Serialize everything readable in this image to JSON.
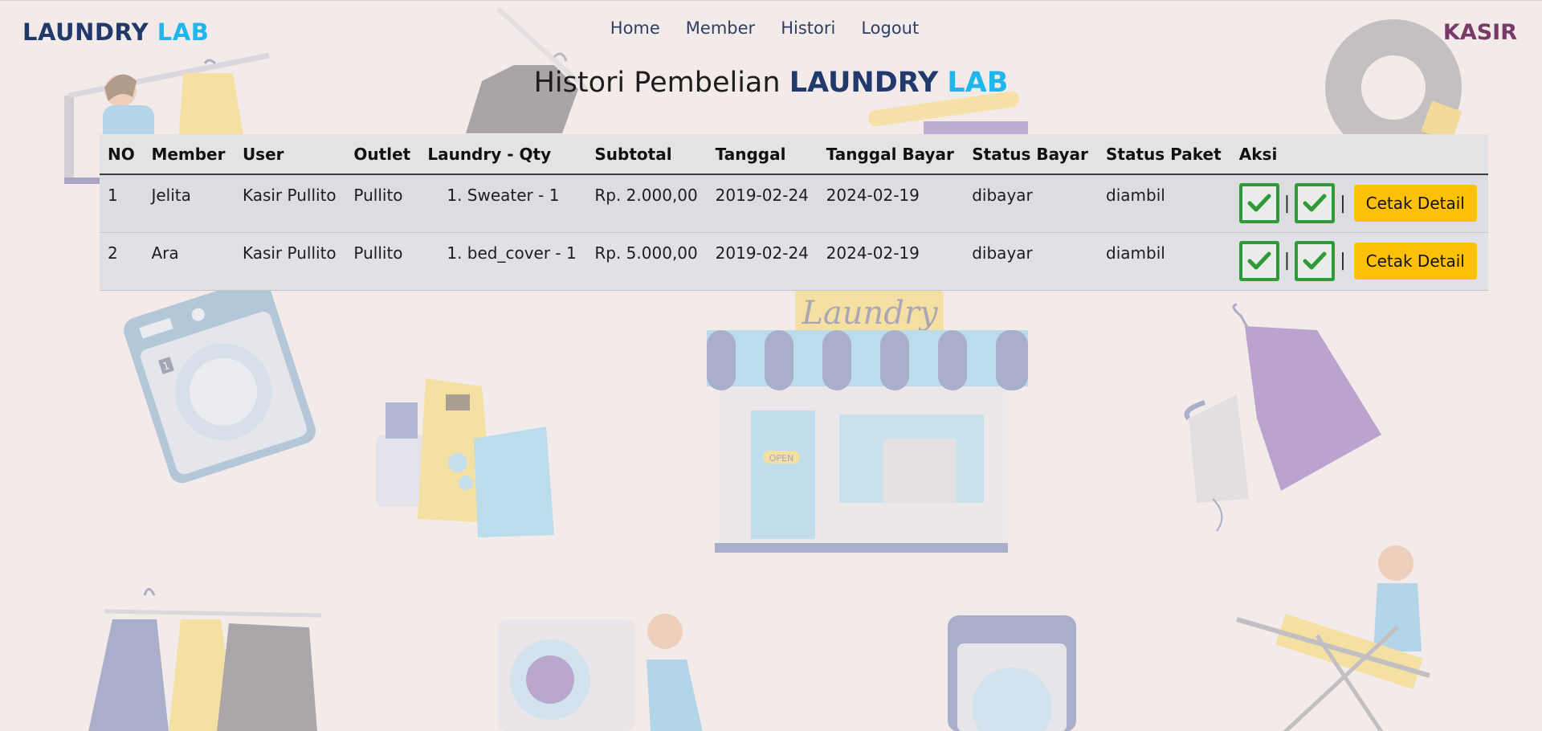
{
  "navbar": {
    "brand_part1": "LAUNDRY",
    "brand_part2": "LAB",
    "links": [
      "Home",
      "Member",
      "Histori",
      "Logout"
    ],
    "role": "KASIR"
  },
  "heading": {
    "prefix": "Histori Pembelian",
    "brand_part1": "LAUNDRY",
    "brand_part2": "LAB"
  },
  "table": {
    "columns": [
      "NO",
      "Member",
      "User",
      "Outlet",
      "Laundry - Qty",
      "Subtotal",
      "Tanggal",
      "Tanggal Bayar",
      "Status Bayar",
      "Status Paket",
      "Aksi"
    ],
    "rows": [
      {
        "no": "1",
        "member": "Jelita",
        "user": "Kasir Pullito",
        "outlet": "Pullito",
        "laundry_qty": "1. Sweater - 1",
        "subtotal": "Rp. 2.000,00",
        "tanggal": "2019-02-24",
        "tanggal_bayar": "2024-02-19",
        "status_bayar": "dibayar",
        "status_paket": "diambil",
        "separator": "|",
        "action_label": "Cetak Detail"
      },
      {
        "no": "2",
        "member": "Ara",
        "user": "Kasir Pullito",
        "outlet": "Pullito",
        "laundry_qty": "1. bed_cover - 1",
        "subtotal": "Rp. 5.000,00",
        "tanggal": "2019-02-24",
        "tanggal_bayar": "2024-02-19",
        "status_bayar": "dibayar",
        "status_paket": "diambil",
        "separator": "|",
        "action_label": "Cetak Detail"
      }
    ]
  },
  "background": {
    "shop_sign": "Laundry",
    "door_sign": "OPEN",
    "machine_number": "1"
  },
  "colors": {
    "brand_dark": "#223a6b",
    "brand_light": "#1fb6ec",
    "role": "#7a3a67",
    "check": "#2f9a37",
    "button": "#ffc107",
    "page_bg": "#f3ebea"
  }
}
